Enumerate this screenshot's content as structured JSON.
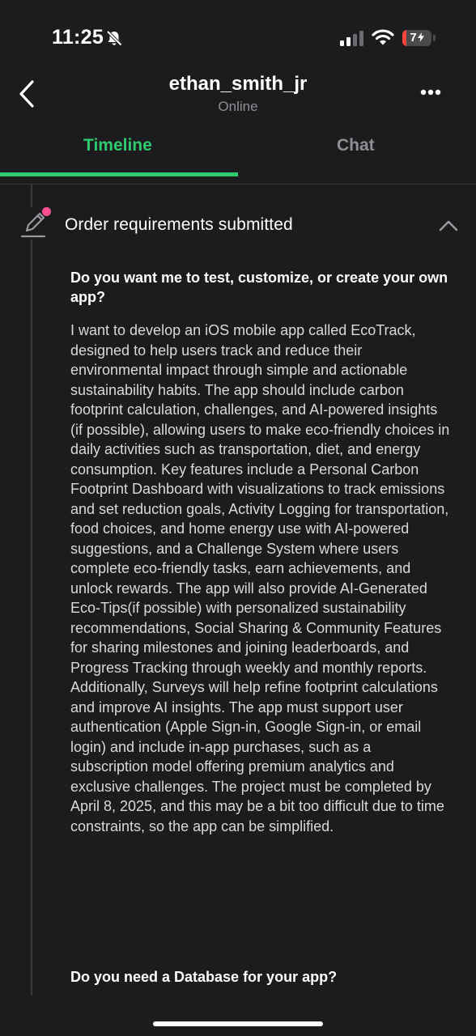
{
  "status_bar": {
    "time": "11:25",
    "battery_level": "7",
    "battery_fraction": 0.15,
    "battery_color": "#ff453a",
    "icons": [
      "bell-slash-icon",
      "signal-icon",
      "wifi-icon",
      "battery-icon"
    ]
  },
  "header": {
    "title": "ethan_smith_jr",
    "status": "Online"
  },
  "tabs": [
    {
      "label": "Timeline",
      "active": true
    },
    {
      "label": "Chat",
      "active": false
    }
  ],
  "colors": {
    "accent": "#2fc96f",
    "background": "#1c1c1e",
    "notification_dot": "#ff4d8d"
  },
  "timeline": {
    "section_title": "Order requirements submitted",
    "questions": [
      {
        "question": "Do you want me to test, customize, or create your own app?",
        "answer": "I want to develop an iOS mobile app called EcoTrack, designed to help users track and reduce their environmental impact through simple and actionable sustainability habits. The app should include carbon footprint calculation, challenges, and AI-powered insights (if possible), allowing users to make eco-friendly choices in daily activities such as transportation, diet, and energy consumption. Key features include a Personal Carbon Footprint Dashboard with visualizations to track emissions and set reduction goals, Activity Logging for transportation, food choices, and home energy use with AI-powered suggestions, and a Challenge System where users complete eco-friendly tasks, earn achievements, and unlock rewards. The app will also provide AI-Generated Eco-Tips(if possible) with personalized sustainability recommendations, Social Sharing & Community Features for sharing milestones and joining leaderboards, and Progress Tracking through weekly and monthly reports. Additionally, Surveys will help refine footprint calculations and improve AI insights. The app must support user authentication (Apple Sign-in, Google Sign-in, or email login) and include in-app purchases, such as a subscription model offering premium analytics and exclusive challenges. The project must be completed by April 8, 2025, and this may be a bit too difficult due to time constraints, so the app can be simplified."
      },
      {
        "question": "Do you need a Database for your app?"
      }
    ]
  }
}
